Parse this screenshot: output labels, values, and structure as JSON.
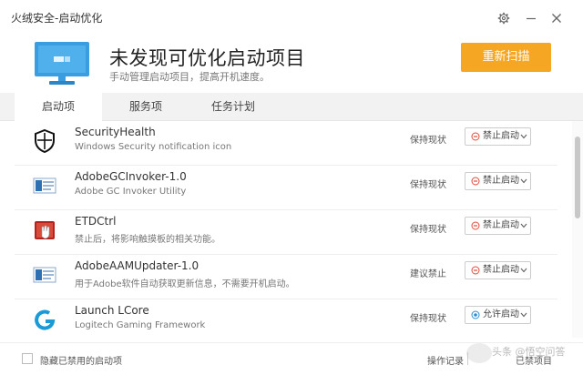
{
  "window": {
    "title": "火绒安全-启动优化",
    "settings_icon": "gear-icon",
    "minimize_icon": "minimize-icon",
    "close_icon": "close-icon"
  },
  "header": {
    "title": "未发现可优化启动项目",
    "subtitle": "手动管理启动项目，提高开机速度。",
    "rescan_label": "重新扫描",
    "accent_color": "#f5a623",
    "monitor_color": "#3a9de0"
  },
  "tabs": [
    {
      "label": "启动项",
      "active": true
    },
    {
      "label": "服务项",
      "active": false
    },
    {
      "label": "任务计划",
      "active": false
    }
  ],
  "items": [
    {
      "name": "SecurityHealth",
      "description": "Windows Security notification icon",
      "status": "保持现状",
      "action": "禁止启动",
      "action_type": "disable",
      "icon": "shield-icon"
    },
    {
      "name": "AdobeGCInvoker-1.0",
      "description": "Adobe GC Invoker Utility",
      "status": "保持现状",
      "action": "禁止启动",
      "action_type": "disable",
      "icon": "adobe-app-icon"
    },
    {
      "name": "ETDCtrl",
      "description": "禁止后，将影响触摸板的相关功能。",
      "status": "保持现状",
      "action": "禁止启动",
      "action_type": "disable",
      "icon": "touchpad-icon"
    },
    {
      "name": "AdobeAAMUpdater-1.0",
      "description": "用于Adobe软件自动获取更新信息，不需要开机启动。",
      "status": "建议禁止",
      "action": "禁止启动",
      "action_type": "disable",
      "icon": "adobe-app-icon"
    },
    {
      "name": "Launch LCore",
      "description": "Logitech Gaming Framework",
      "status": "保持现状",
      "action": "允许启动",
      "action_type": "allow",
      "icon": "logitech-icon"
    }
  ],
  "footer": {
    "hide_disabled_label": "隐藏已禁用的启动项",
    "log_label": "操作记录",
    "count_label": "已禁项目",
    "watermark": "头条 @悟空问答"
  }
}
